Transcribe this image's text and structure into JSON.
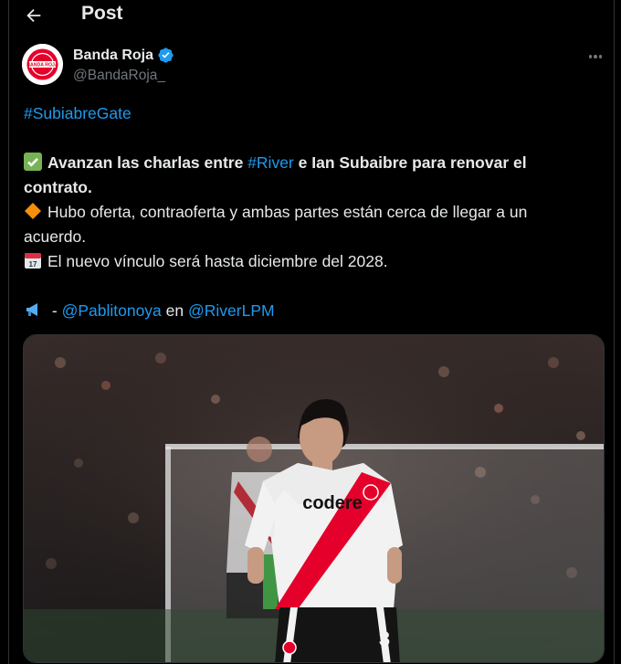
{
  "header": {
    "title": "Post"
  },
  "author": {
    "name": "Banda Roja",
    "handle": "@BandaRoja_",
    "logo_text": "BANDA ROJA"
  },
  "tweet": {
    "hashtag_top": "#SubiabreGate",
    "line1_bold_a": "Avanzan las charlas entre ",
    "line1_link": "#River",
    "line1_bold_b": " e Ian Subaibre para renovar el",
    "line2_bold": "contrato.",
    "line3": "Hubo oferta, contraoferta y ambas partes están cerca de llegar a un",
    "line4": "acuerdo.",
    "line5": "El nuevo vínculo será hasta diciembre del 2028.",
    "source_sep": " - ",
    "source_user": "@Pablitonoya",
    "source_en": " en ",
    "source_outlet": "@RiverLPM"
  },
  "media": {
    "sponsor_text": "codere",
    "number_text": "3"
  },
  "colors": {
    "accent": "#1d9bf0",
    "background": "#000000",
    "muted": "#71767b",
    "text": "#e7e9ea",
    "brand_red": "#e4002b"
  },
  "icons": {
    "back": "arrow-left-icon",
    "verified": "verified-badge-icon",
    "more": "more-dots-icon",
    "check": "check-mark-emoji",
    "diamond": "orange-diamond-emoji",
    "calendar": "calendar-emoji",
    "megaphone": "megaphone-emoji"
  }
}
